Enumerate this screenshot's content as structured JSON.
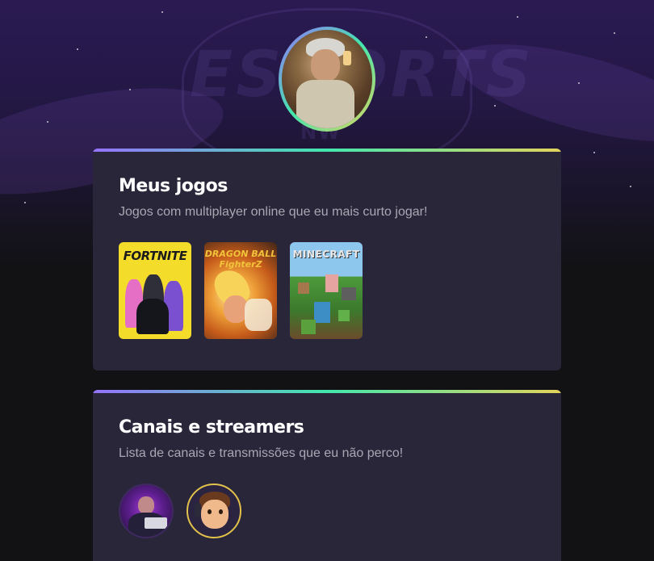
{
  "profile": {
    "avatar_icon": "profile-photo-icon"
  },
  "background": {
    "logo_text": "ESPORTS",
    "logo_sub": "NW"
  },
  "games_section": {
    "title": "Meus jogos",
    "description": "Jogos com multiplayer online que eu mais curto jogar!",
    "games": [
      {
        "label": "FORTNITE",
        "icon": "fortnite-cover"
      },
      {
        "label": "DRAGON BALL FighterZ",
        "icon": "dragon-ball-cover"
      },
      {
        "label": "MINECRAFT",
        "icon": "minecraft-cover"
      }
    ]
  },
  "streamers_section": {
    "title": "Canais e streamers",
    "description": "Lista de canais e transmissões que eu não perco!",
    "streamers": [
      {
        "icon": "streamer-avatar-1"
      },
      {
        "icon": "streamer-avatar-2"
      }
    ]
  },
  "colors": {
    "accent_gradient": [
      "#9572fc",
      "#43e7ad",
      "#e2d45c"
    ],
    "card_bg": "#29263a",
    "page_bg": "#121214",
    "title": "#ffffff",
    "text_muted": "#a8a8b3"
  }
}
